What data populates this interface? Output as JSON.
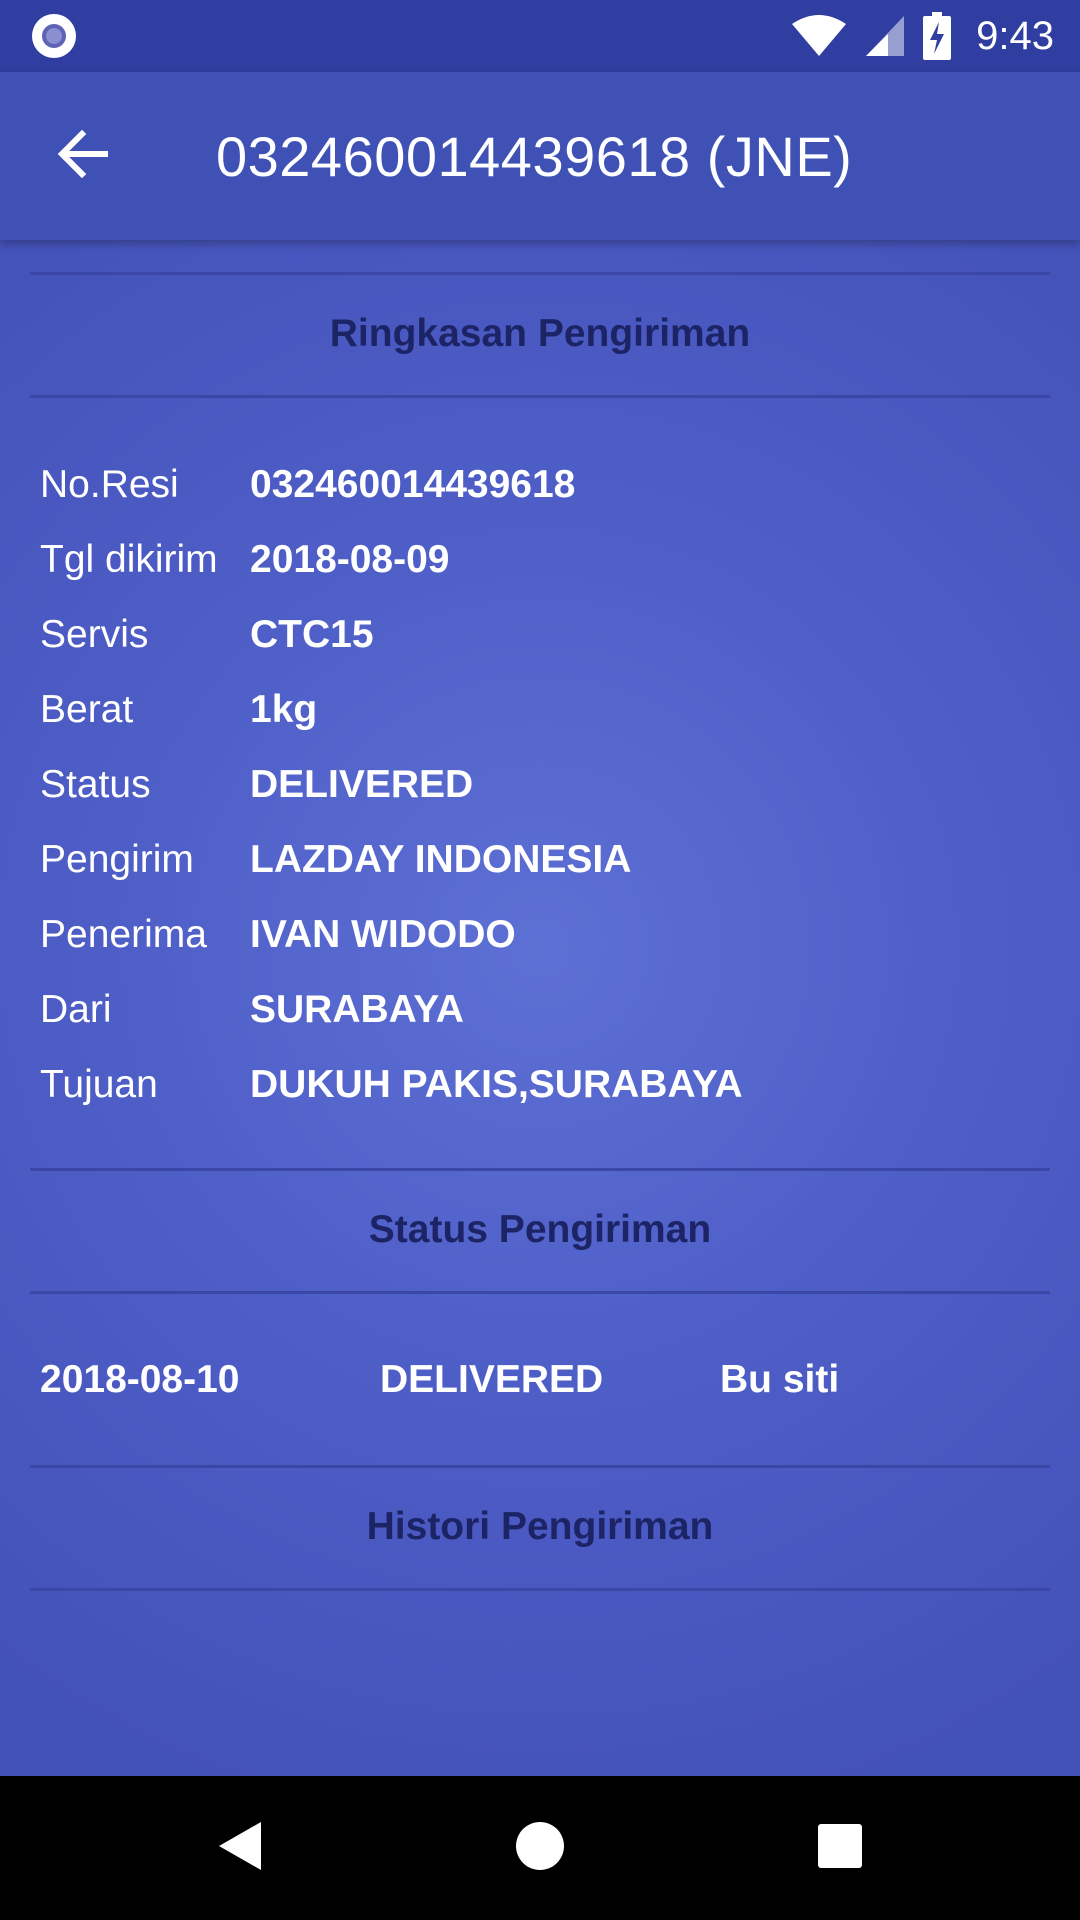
{
  "status_bar": {
    "time": "9:43",
    "icons": [
      "notification-icon",
      "wifi-icon",
      "signal-icon",
      "battery-charging-icon"
    ]
  },
  "app_bar": {
    "title": "032460014439618 (JNE)",
    "back_icon": "arrow-left-icon"
  },
  "summary": {
    "title": "Ringkasan Pengiriman",
    "rows": [
      {
        "label": "No.Resi",
        "value": "032460014439618"
      },
      {
        "label": "Tgl dikirim",
        "value": "2018-08-09"
      },
      {
        "label": "Servis",
        "value": "CTC15"
      },
      {
        "label": "Berat",
        "value": "1kg"
      },
      {
        "label": "Status",
        "value": "DELIVERED"
      },
      {
        "label": "Pengirim",
        "value": "LAZDAY INDONESIA"
      },
      {
        "label": "Penerima",
        "value": "IVAN WIDODO"
      },
      {
        "label": "Dari",
        "value": "SURABAYA"
      },
      {
        "label": "Tujuan",
        "value": "DUKUH PAKIS,SURABAYA"
      }
    ]
  },
  "delivery_status": {
    "title": "Status Pengiriman",
    "date": "2018-08-10",
    "status": "DELIVERED",
    "receiver": "Bu siti"
  },
  "history": {
    "title": "Histori Pengiriman"
  },
  "nav_bar": {
    "icons": [
      "back-triangle-icon",
      "home-circle-icon",
      "recents-square-icon"
    ]
  },
  "colors": {
    "status_bar": "#2f3ea0",
    "app_bar": "#3f51b5",
    "section_title": "#1c2466",
    "text": "#ffffff"
  }
}
